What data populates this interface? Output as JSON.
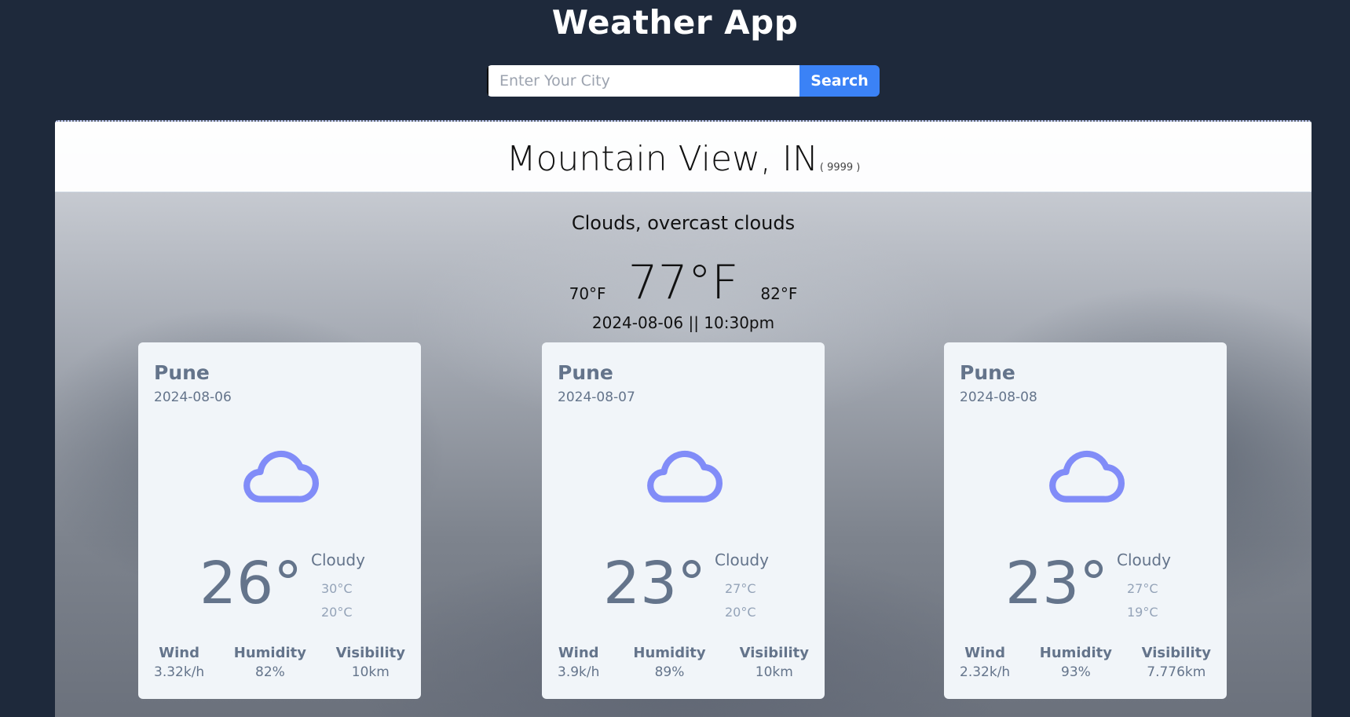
{
  "app": {
    "title": "Weather App"
  },
  "search": {
    "placeholder": "Enter Your City",
    "button_label": "Search"
  },
  "current": {
    "city": "Mountain View, IN",
    "code": "( 9999 )",
    "description": "Clouds, overcast clouds",
    "temp_min": "70°F",
    "temp": "77°F",
    "temp_max": "82°F",
    "datetime": "2024-08-06 || 10:30pm"
  },
  "forecast": [
    {
      "city": "Pune",
      "date": "2024-08-06",
      "icon": "cloud-icon",
      "temp": "26°",
      "condition": "Cloudy",
      "high": "30°C",
      "low": "20°C",
      "wind_label": "Wind",
      "wind": "3.32k/h",
      "humidity_label": "Humidity",
      "humidity": "82%",
      "visibility_label": "Visibility",
      "visibility": "10km"
    },
    {
      "city": "Pune",
      "date": "2024-08-07",
      "icon": "cloud-icon",
      "temp": "23°",
      "condition": "Cloudy",
      "high": "27°C",
      "low": "20°C",
      "wind_label": "Wind",
      "wind": "3.9k/h",
      "humidity_label": "Humidity",
      "humidity": "89%",
      "visibility_label": "Visibility",
      "visibility": "10km"
    },
    {
      "city": "Pune",
      "date": "2024-08-08",
      "icon": "cloud-icon",
      "temp": "23°",
      "condition": "Cloudy",
      "high": "27°C",
      "low": "19°C",
      "wind_label": "Wind",
      "wind": "2.32k/h",
      "humidity_label": "Humidity",
      "humidity": "93%",
      "visibility_label": "Visibility",
      "visibility": "7.776km"
    }
  ],
  "colors": {
    "background": "#1e293b",
    "accent": "#3b82f6",
    "icon": "#818cf8",
    "card": "#f1f5f9"
  }
}
